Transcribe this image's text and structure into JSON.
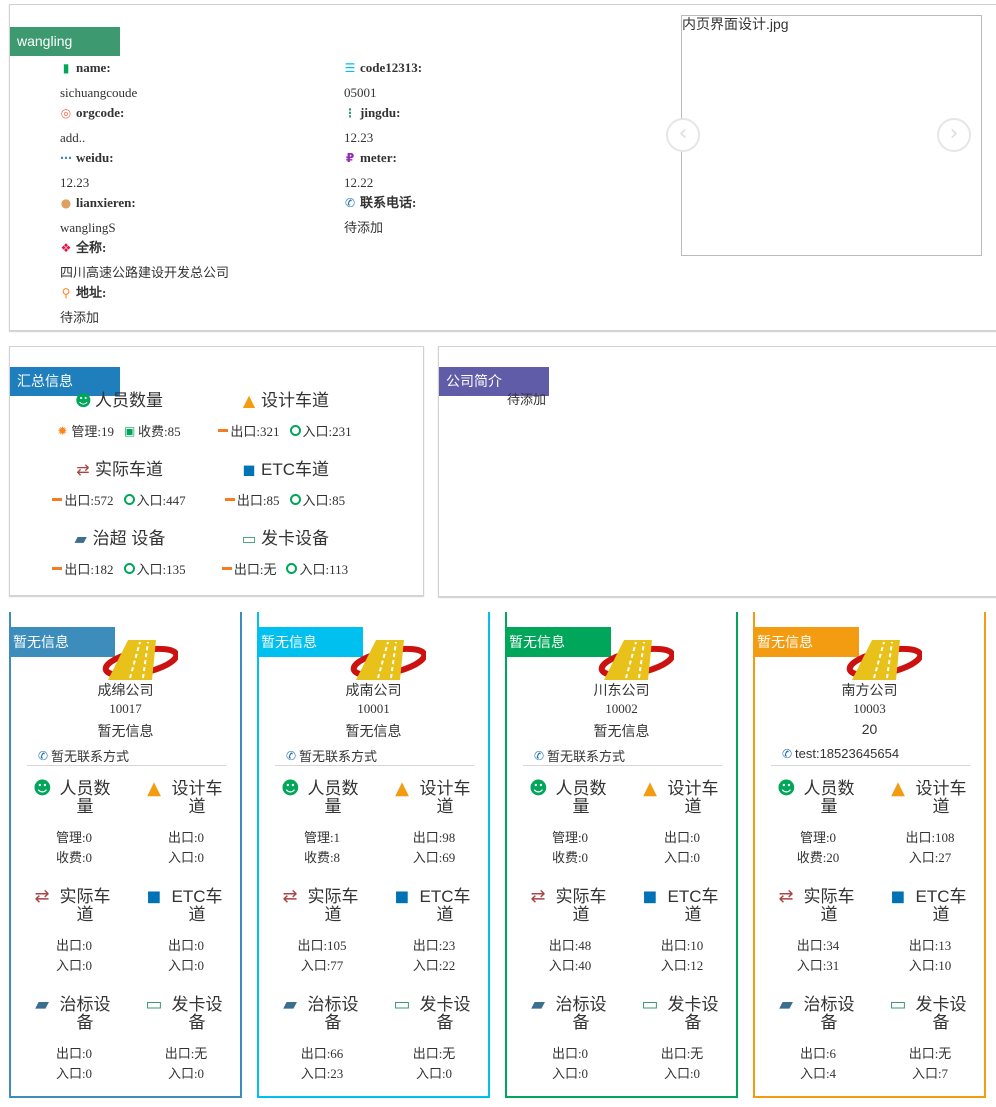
{
  "top": {
    "title": "wangling",
    "fields": [
      {
        "label": "name:",
        "value": "sichuangcoude",
        "icon": "bookmark-icon",
        "color": "#00a65a"
      },
      {
        "label": "code12313:",
        "value": "05001",
        "icon": "list-icon",
        "color": "#00c0ef"
      },
      {
        "label": "orgcode:",
        "value": "add..",
        "icon": "life-ring-icon",
        "color": "#f56954"
      },
      {
        "label": "jingdu:",
        "value": "12.23",
        "icon": "ellipsis-vertical-icon",
        "color": "#3d9970"
      },
      {
        "label": "weidu:",
        "value": "12.23",
        "icon": "ellipsis-horizontal-icon",
        "color": "#3c8dbc"
      },
      {
        "label": "meter:",
        "value": "12.22",
        "icon": "ruble-icon",
        "color": "#932ab6"
      },
      {
        "label": "lianxieren:",
        "value": "wanglingS",
        "icon": "user-icon",
        "color": "#e0a060"
      },
      {
        "label": "联系电话:",
        "value": "待添加",
        "icon": "phone-icon",
        "color": "#1f6fb2"
      },
      {
        "label": "全称:",
        "value": "四川高速公路建设开发总公司",
        "icon": "cubes-icon",
        "color": "#dd1144"
      },
      {
        "label": "地址:",
        "value": "待添加",
        "icon": "map-marker-icon",
        "color": "#ff851b"
      }
    ],
    "gallery": {
      "caption": "内页界面设计.jpg",
      "prev": "‹",
      "next": "›"
    }
  },
  "summary": {
    "title": "汇总信息",
    "groups": [
      {
        "title": "人员数量",
        "icon": "users-icon",
        "color": "#00a65a",
        "items": [
          {
            "icon": "gear-icon",
            "text": "管理:19"
          },
          {
            "icon": "money-icon",
            "text": "收费:85"
          }
        ]
      },
      {
        "title": "设计车道",
        "icon": "road-icon",
        "color": "#f39c12",
        "items": [
          {
            "icon": "dash-icon",
            "text": "出口:321"
          },
          {
            "icon": "circle-icon",
            "text": "入口:231"
          }
        ]
      },
      {
        "title": "实际车道",
        "icon": "exchange-icon",
        "color": "#a94442",
        "items": [
          {
            "icon": "dash-icon",
            "text": "出口:572"
          },
          {
            "icon": "circle-icon",
            "text": "入口:447"
          }
        ]
      },
      {
        "title": "ETC车道",
        "icon": "car-icon",
        "color": "#0073b7",
        "items": [
          {
            "icon": "dash-icon",
            "text": "出口:85"
          },
          {
            "icon": "circle-icon",
            "text": "入口:85"
          }
        ]
      },
      {
        "title": "治超 设备",
        "icon": "truck-icon",
        "color": "#3c6e8f",
        "items": [
          {
            "icon": "dash-icon",
            "text": "出口:182"
          },
          {
            "icon": "circle-icon",
            "text": "入口:135"
          }
        ]
      },
      {
        "title": "发卡设备",
        "icon": "credit-card-icon",
        "color": "#3d9970",
        "items": [
          {
            "icon": "dash-icon",
            "text": "出口:无"
          },
          {
            "icon": "circle-icon",
            "text": "入口:113"
          }
        ]
      }
    ]
  },
  "intro": {
    "title": "公司简介",
    "text": "待添加"
  },
  "companies": [
    {
      "tag": "暂无信息",
      "color": "#3c8dbc",
      "name": "成绵公司",
      "code": "10017",
      "desc": "暂无信息",
      "phone": "暂无联系方式",
      "stats": [
        {
          "title": "人员数量",
          "lines": [
            "管理:0",
            "收费:0"
          ]
        },
        {
          "title": "设计车道",
          "lines": [
            "出口:0",
            "入口:0"
          ]
        },
        {
          "title": "实际车道",
          "lines": [
            "出口:0",
            "入口:0"
          ]
        },
        {
          "title": "ETC车道",
          "lines": [
            "出口:0",
            "入口:0"
          ]
        },
        {
          "title": "治标设备",
          "lines": [
            "出口:0",
            "入口:0"
          ]
        },
        {
          "title": "发卡设备",
          "lines": [
            "出口:无",
            "入口:0"
          ]
        }
      ]
    },
    {
      "tag": "暂无信息",
      "color": "#00c0ef",
      "name": "成南公司",
      "code": "10001",
      "desc": "暂无信息",
      "phone": "暂无联系方式",
      "stats": [
        {
          "title": "人员数量",
          "lines": [
            "管理:1",
            "收费:8"
          ]
        },
        {
          "title": "设计车道",
          "lines": [
            "出口:98",
            "入口:69"
          ]
        },
        {
          "title": "实际车道",
          "lines": [
            "出口:105",
            "入口:77"
          ]
        },
        {
          "title": "ETC车道",
          "lines": [
            "出口:23",
            "入口:22"
          ]
        },
        {
          "title": "治标设备",
          "lines": [
            "出口:66",
            "入口:23"
          ]
        },
        {
          "title": "发卡设备",
          "lines": [
            "出口:无",
            "入口:0"
          ]
        }
      ]
    },
    {
      "tag": "暂无信息",
      "color": "#00a65a",
      "name": "川东公司",
      "code": "10002",
      "desc": "暂无信息",
      "phone": "暂无联系方式",
      "stats": [
        {
          "title": "人员数量",
          "lines": [
            "管理:0",
            "收费:0"
          ]
        },
        {
          "title": "设计车道",
          "lines": [
            "出口:0",
            "入口:0"
          ]
        },
        {
          "title": "实际车道",
          "lines": [
            "出口:48",
            "入口:40"
          ]
        },
        {
          "title": "ETC车道",
          "lines": [
            "出口:10",
            "入口:12"
          ]
        },
        {
          "title": "治标设备",
          "lines": [
            "出口:0",
            "入口:0"
          ]
        },
        {
          "title": "发卡设备",
          "lines": [
            "出口:无",
            "入口:0"
          ]
        }
      ]
    },
    {
      "tag": "暂无信息",
      "color": "#f39c12",
      "name": "南方公司",
      "code": "10003",
      "desc": "20",
      "phone": "test:18523645654",
      "stats": [
        {
          "title": "人员数量",
          "lines": [
            "管理:0",
            "收费:20"
          ]
        },
        {
          "title": "设计车道",
          "lines": [
            "出口:108",
            "入口:27"
          ]
        },
        {
          "title": "实际车道",
          "lines": [
            "出口:34",
            "入口:31"
          ]
        },
        {
          "title": "ETC车道",
          "lines": [
            "出口:13",
            "入口:10"
          ]
        },
        {
          "title": "治标设备",
          "lines": [
            "出口:6",
            "入口:4"
          ]
        },
        {
          "title": "发卡设备",
          "lines": [
            "出口:无",
            "入口:7"
          ]
        }
      ]
    }
  ],
  "stat_icons": [
    {
      "icon": "users-icon",
      "color": "#00a65a"
    },
    {
      "icon": "road-icon",
      "color": "#f39c12"
    },
    {
      "icon": "exchange-icon",
      "color": "#a94442"
    },
    {
      "icon": "car-icon",
      "color": "#0073b7"
    },
    {
      "icon": "truck-icon",
      "color": "#3c6e8f"
    },
    {
      "icon": "credit-card-icon",
      "color": "#3d9970"
    }
  ]
}
